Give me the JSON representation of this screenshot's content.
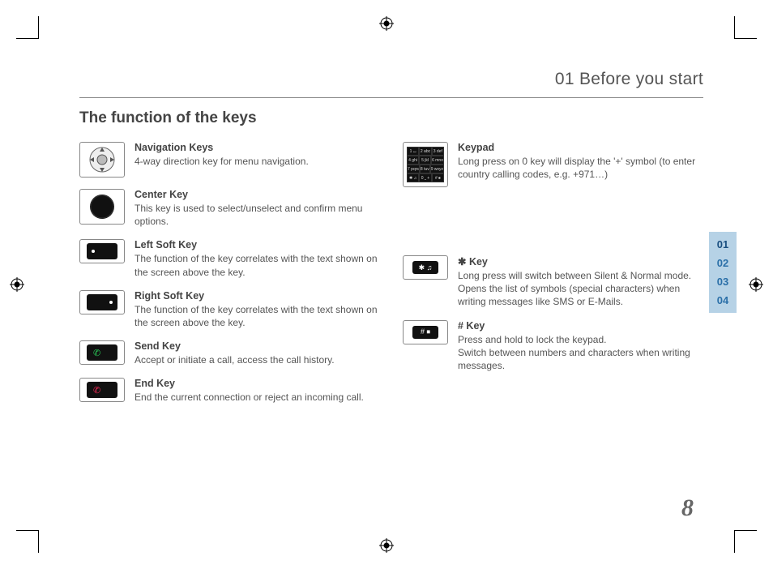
{
  "chapter": "01 Before you start",
  "section_title": "The function of the keys",
  "page_number": "8",
  "tabs": [
    "01",
    "02",
    "03",
    "04"
  ],
  "left_items": [
    {
      "title": "Navigation Keys",
      "body": "4-way direction key for menu navigation."
    },
    {
      "title": "Center Key",
      "body": "This key is used to select/unselect and confirm menu options."
    },
    {
      "title": "Left Soft Key",
      "body": "The function of the key correlates with the text shown on the screen above the key."
    },
    {
      "title": "Right Soft Key",
      "body": "The function of the key correlates with the text shown on the screen above the key."
    },
    {
      "title": "Send Key",
      "body": "Accept or initiate a call, access the call history."
    },
    {
      "title": "End Key",
      "body": "End the current connection or reject an incoming call."
    }
  ],
  "right_items": [
    {
      "title": "Keypad",
      "body": "Long press on 0 key will display the '+' symbol (to enter country calling codes, e.g. +971…)"
    },
    {
      "title": "✱ Key",
      "body": "Long press will switch between Silent & Normal mode. Opens the list of symbols (special characters) when writing messages like SMS or E-Mails."
    },
    {
      "title": "# Key",
      "body": "Press and hold to lock the keypad.\nSwitch between numbers and characters when writing messages."
    }
  ],
  "keypad_labels": [
    [
      "1 ⌴",
      "2 abc",
      "3 def"
    ],
    [
      "4 ghi",
      "5 jkl",
      "6 mno"
    ],
    [
      "7 pqrs",
      "8 tuv",
      "9 wxyz"
    ],
    [
      "✱ ♫",
      "0 ⎵ +",
      "# ⏹"
    ]
  ]
}
